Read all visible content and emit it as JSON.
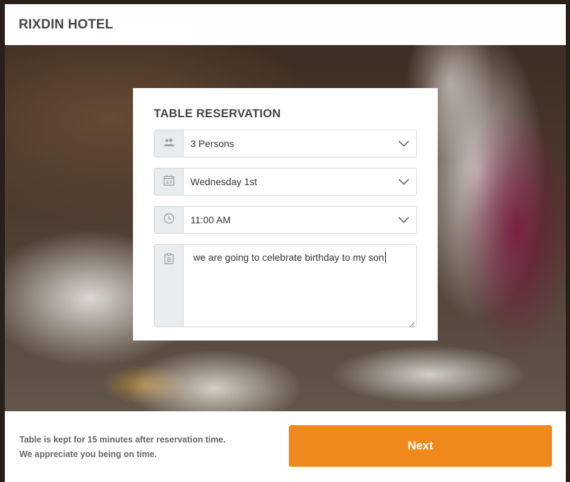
{
  "header": {
    "title": "RIXDIN HOTEL"
  },
  "reservation": {
    "title": "TABLE RESERVATION",
    "persons": {
      "value": "3 Persons",
      "icon": "people-icon"
    },
    "date": {
      "value": "Wednesday 1st",
      "icon": "calendar-icon"
    },
    "time": {
      "value": "11:00 AM",
      "icon": "clock-icon"
    },
    "notes": {
      "value": "we are going to celebrate birthday to my son",
      "icon": "notes-icon"
    }
  },
  "footer": {
    "note_line1": "Table is kept for 15 minutes after reservation time.",
    "note_line2": "We appreciate you being on time.",
    "next_label": "Next"
  },
  "colors": {
    "accent": "#f0891c",
    "addon_bg": "#e8ecee",
    "text": "#444444"
  }
}
